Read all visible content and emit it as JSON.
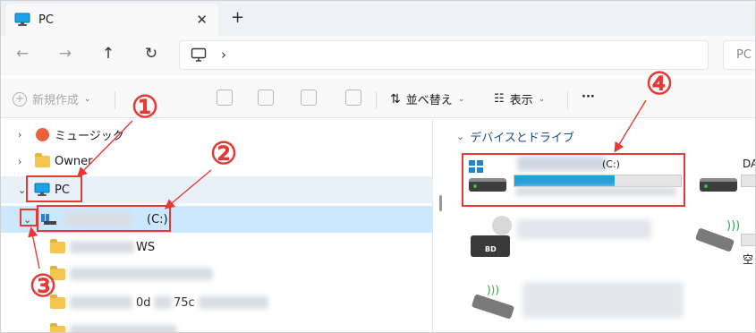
{
  "tab": {
    "title": "PC",
    "close_glyph": "✕",
    "new_tab_glyph": "+"
  },
  "nav": {
    "back_glyph": "←",
    "forward_glyph": "→",
    "up_glyph": "↑",
    "refresh_glyph": "↻",
    "address_chevron": "›",
    "search_placeholder": "PC"
  },
  "commands": {
    "new_label": "新規作成",
    "sort_label": "並べ替え",
    "view_label": "表示",
    "more_label": "···"
  },
  "tree": {
    "music_label": "ミュージック",
    "owner_label": "Owner",
    "pc_label": "PC",
    "drive_c_label": "(C:)",
    "windows_suffix": "WS",
    "partial_text": "0d",
    "partial_text_2": "75c"
  },
  "content": {
    "group_header": "デバイスとドライブ",
    "drive_c_label": "(C:)",
    "drive_c_used_fraction": 0.6,
    "drive_d_label": "DA",
    "bd_badge": "BD",
    "usb_partial_label": "空"
  },
  "annotations": {
    "num1": "①",
    "num2": "②",
    "num3": "③",
    "num4": "④",
    "color": "#e53935"
  },
  "colors": {
    "selection": "#cce8ff",
    "accent": "#26a0da",
    "header_text": "#1a4c8a"
  }
}
